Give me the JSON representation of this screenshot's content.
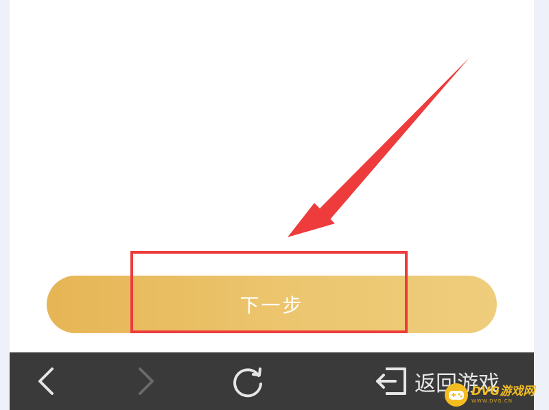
{
  "main": {
    "next_button_label": "下一步"
  },
  "bottom_bar": {
    "back_icon": "chevron-left-icon",
    "forward_icon": "chevron-right-icon",
    "refresh_icon": "refresh-icon",
    "return_icon": "exit-icon",
    "return_label": "返回游戏"
  },
  "watermark": {
    "text": "DVG游戏网",
    "subtext": "WWW.DVG.CN"
  },
  "colors": {
    "button_gradient_start": "#e6b555",
    "button_gradient_end": "#eecd7c",
    "annotation_red": "#ee3b3b",
    "bottom_bar": "#3a3a3a",
    "watermark_yellow": "#f3bd21"
  }
}
